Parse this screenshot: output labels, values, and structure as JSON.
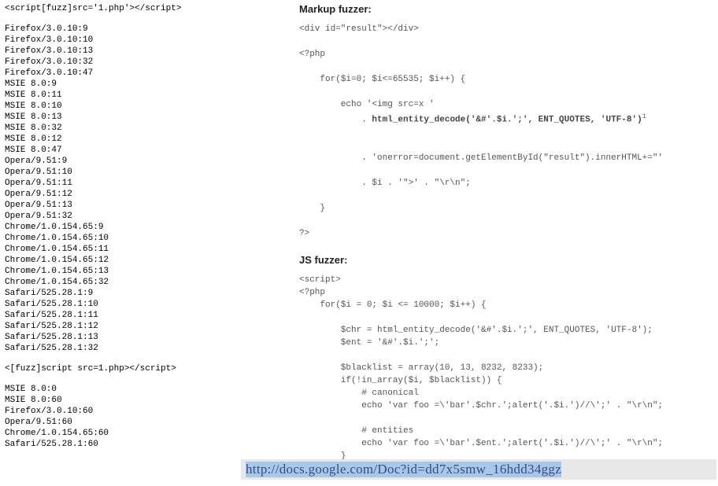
{
  "left": {
    "snippet1": "<script[fuzz]src='1.php'></script>",
    "list1": "Firefox/3.0.10:9\nFirefox/3.0.10:10\nFirefox/3.0.10:13\nFirefox/3.0.10:32\nFirefox/3.0.10:47\nMSIE 8.0:9\nMSIE 8.0:11\nMSIE 8.0:10\nMSIE 8.0:13\nMSIE 8.0:32\nMSIE 8.0:12\nMSIE 8.0:47\nOpera/9.51:9\nOpera/9.51:10\nOpera/9.51:11\nOpera/9.51:12\nOpera/9.51:13\nOpera/9.51:32\nChrome/1.0.154.65:9\nChrome/1.0.154.65:10\nChrome/1.0.154.65:11\nChrome/1.0.154.65:12\nChrome/1.0.154.65:13\nChrome/1.0.154.65:32\nSafari/525.28.1:9\nSafari/525.28.1:10\nSafari/525.28.1:11\nSafari/525.28.1:12\nSafari/525.28.1:13\nSafari/525.28.1:32",
    "snippet2": "<[fuzz]script src=1.php></script>",
    "list2": "MSIE 8.0:0\nMSIE 8.0:60\nFirefox/3.0.10:60\nOpera/9.51:60\nChrome/1.0.154.65:60\nSafari/525.28.1:60"
  },
  "right": {
    "heading1": "Markup fuzzer:",
    "markup_code_pre": "<div id=\"result\"></div>\n\n<?php\n\n    for($i=0; $i<=65535; $i++) {\n\n        echo '<img src=x '\n            . ",
    "markup_code_bold": "html_entity_decode('&#'.$i.';', ENT_QUOTES, 'UTF-8')",
    "markup_sup": "1",
    "markup_code_post": "\n\n\n            . 'onerror=document.getElementById(\"result\").innerHTML+=\"'\n\n            . $i . '\">' . \"\\r\\n\";\n\n    }\n\n?>",
    "heading2": "JS fuzzer:",
    "js_code": "<script>\n<?php\n    for($i = 0; $i <= 10000; $i++) {\n\n        $chr = html_entity_decode('&#'.$i.';', ENT_QUOTES, 'UTF-8');\n        $ent = '&#'.$i.';';\n\n        $blacklist = array(10, 13, 8232, 8233);\n        if(!in_array($i, $blacklist)) {\n            # canonical\n            echo 'var foo =\\'bar'.$chr.';alert('.$i.')//\\';' . \"\\r\\n\";\n\n            # entities\n            echo 'var foo =\\'bar'.$ent.';alert('.$i.')//\\';' . \"\\r\\n\";\n        }"
  },
  "url": "http://docs.google.com/Doc?id=dd7x5smw_16hdd34ggz"
}
